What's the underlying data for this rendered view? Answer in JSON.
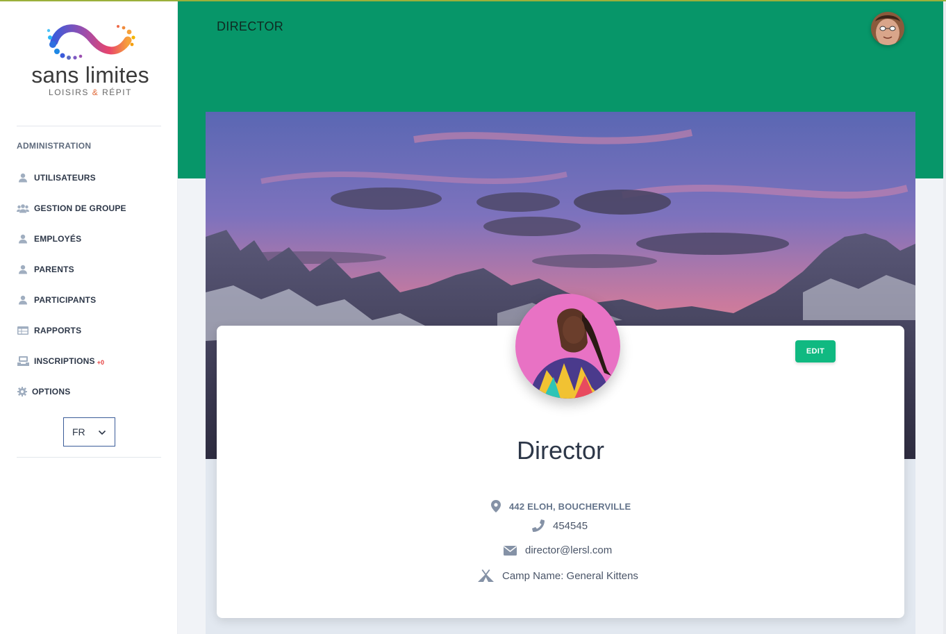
{
  "brand": {
    "name": "sans limites",
    "tagline_part1": "LOISIRS",
    "tagline_amp": "&",
    "tagline_part2": "RÉPIT"
  },
  "sidebar": {
    "section_title": "ADMINISTRATION",
    "items": [
      {
        "label": "UTILISATEURS",
        "icon": "user-icon"
      },
      {
        "label": "GESTION DE GROUPE",
        "icon": "users-group-icon"
      },
      {
        "label": "EMPLOYÉS",
        "icon": "user-icon"
      },
      {
        "label": "PARENTS",
        "icon": "user-icon"
      },
      {
        "label": "PARTICIPANTS",
        "icon": "user-icon"
      },
      {
        "label": "RAPPORTS",
        "icon": "table-icon"
      },
      {
        "label": "INSCRIPTIONS",
        "icon": "inbox-icon",
        "badge": "+0"
      },
      {
        "label": "OPTIONS",
        "icon": "gear-icon"
      }
    ],
    "language": "FR"
  },
  "header": {
    "title": "DIRECTOR"
  },
  "profile": {
    "name": "Director",
    "edit_label": "EDIT",
    "address": "442 ELOH, BOUCHERVILLE",
    "phone": "454545",
    "email": "director@lersl.com",
    "camp": "Camp Name: General Kittens"
  },
  "colors": {
    "header_green": "#079669",
    "edit_button": "#10b981",
    "nav_icon": "#a0aec0",
    "badge_red": "#e53e3e"
  }
}
